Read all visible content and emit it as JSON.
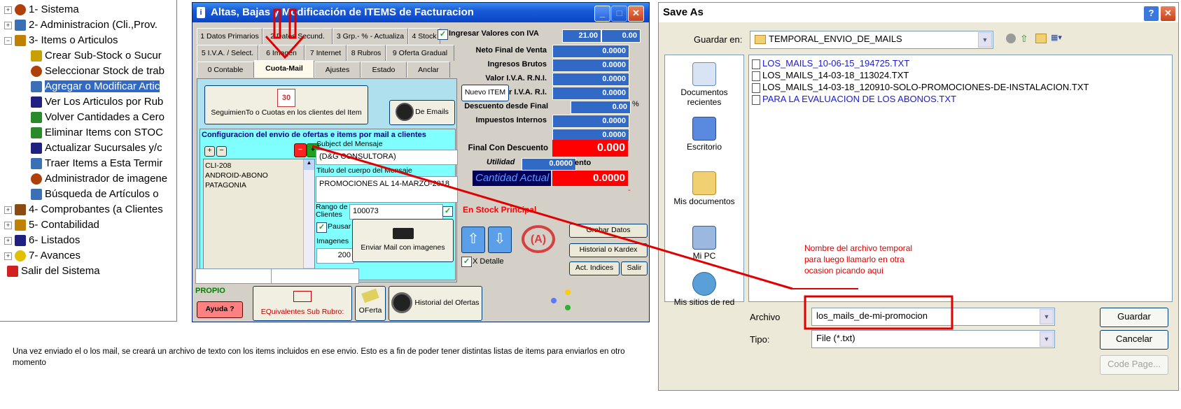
{
  "tree": {
    "items": [
      {
        "pm": "+",
        "label": "1- Sistema",
        "icon": "gear-icon",
        "color": "#b0400a"
      },
      {
        "pm": "+",
        "label": "2- Administracion (Cli.,Prov.",
        "icon": "doc-icon",
        "color": "#3b6fb6"
      },
      {
        "pm": "−",
        "label": "3- Items o Articulos",
        "icon": "folder-tree-icon",
        "color": "#c08000"
      },
      {
        "pm": "",
        "label": "Crear Sub-Stock o Sucur",
        "icon": "hand-icon",
        "color": "#c8a000"
      },
      {
        "pm": "",
        "label": "Seleccionar Stock de trab",
        "icon": "gear-icon",
        "color": "#b0400a"
      },
      {
        "pm": "",
        "label": "Agregar o Modificar Artic",
        "icon": "pen-icon",
        "color": "#3b6fb6"
      },
      {
        "pm": "",
        "label": "Ver Los Articulos por Rub",
        "icon": "chart-icon",
        "color": "#202080"
      },
      {
        "pm": "",
        "label": "Volver Cantidades a Cero",
        "icon": "traffic-light-icon",
        "color": "#2a8a2a"
      },
      {
        "pm": "",
        "label": "Eliminar Items con STOC",
        "icon": "traffic-light-icon",
        "color": "#2a8a2a"
      },
      {
        "pm": "",
        "label": "Actualizar Sucursales y/c",
        "icon": "chart-icon",
        "color": "#202080"
      },
      {
        "pm": "",
        "label": "Traer Items a Esta Termir",
        "icon": "arrows-icon",
        "color": "#3b6fb6"
      },
      {
        "pm": "",
        "label": "Administrador de imagene",
        "icon": "gear-icon",
        "color": "#b0400a"
      },
      {
        "pm": "",
        "label": "Búsqueda de Artículos o",
        "icon": "pen-icon",
        "color": "#3b6fb6"
      },
      {
        "pm": "+",
        "label": "4- Comprobantes (a Clientes",
        "icon": "books-icon",
        "color": "#8a4a10"
      },
      {
        "pm": "+",
        "label": "5- Contabilidad",
        "icon": "ledger-icon",
        "color": "#c08000"
      },
      {
        "pm": "+",
        "label": "6- Listados",
        "icon": "chart-icon",
        "color": "#202080"
      },
      {
        "pm": "+",
        "label": "7- Avances",
        "icon": "smiley-icon",
        "color": "#e0c000"
      },
      {
        "pm": "",
        "label": "Salir del Sistema",
        "icon": "x-icon",
        "color": "#d02020"
      }
    ]
  },
  "main": {
    "title": "Altas, Bajas y Modificación de ITEMS de Facturacion",
    "tabs_row1": [
      "1 Datos Primarios",
      "2 Datos Secund.",
      "3 Grp.- % - Actualiza",
      "4 Stock"
    ],
    "tabs_row2": [
      "5 I.V.A. / Select.",
      "6 Imagen",
      "7 Internet",
      "8 Rubros",
      "9 Oferta Gradual"
    ],
    "tabs_row3": [
      "0 Contable",
      "Cuota-Mail",
      "Ajustes",
      "Estado",
      "Anclar"
    ],
    "seguimiento_btn": "SeguimienTo o Cuotas en los clientes del Item",
    "calendar_num": "30",
    "de_emails_btn": "De Emails",
    "config_title": "Configuracion del envio de ofertas e items por mail a clientes",
    "plus": "+",
    "minus": "−",
    "client_list": [
      "CLI-208",
      "ANDROID-ABONO",
      "PATAGONIA"
    ],
    "subject_label": "Subject del Mensaje",
    "subject_value": "(D&G CONSULTORA)",
    "titulo_label": "Titulo del cuerpo del Mensaje",
    "titulo_value": "PROMOCIONES AL 14-MARZO-2018",
    "rango_label": "Rango de Clientes",
    "rango_value": "100073",
    "pausar_label": "Pausar",
    "imagenes_label": "Imagenes",
    "imagenes_value": "200",
    "enviar_btn": "Enviar Mail con imagenes",
    "ingresar_iva_label": "Ingresar Valores con IVA",
    "iva_rate": "21.00",
    "iva_value": "0.00",
    "fields": [
      {
        "label": "Neto Final de Venta",
        "value": "0.0000"
      },
      {
        "label": "Ingresos Brutos",
        "value": "0.0000"
      },
      {
        "label": "Valor I.V.A. R.N.I.",
        "value": "0.0000"
      },
      {
        "label": "Valor I.V.A. R.I.",
        "value": "0.0000"
      },
      {
        "label": "Descuento desde Final",
        "value": "0.00"
      },
      {
        "label": "Impuestos Internos",
        "value": "0.0000"
      },
      {
        "label": "",
        "value": "0.0000"
      }
    ],
    "nuevo_item_btn": "Nuevo ITEM",
    "percent": "%",
    "final_descuento_label": "Final Con Descuento",
    "final_descuento_value": "0.000",
    "utilidad_label": "Utilidad",
    "utilidad_value": "0.0000",
    "utilidad_suffix": "ento",
    "cantidad_label": "Cantidad Actual",
    "cantidad_value": "0.0000",
    "dot": "-",
    "stock_label": "En Stock Principal",
    "grabar_btn": "Grabar Datos",
    "historial_btn": "Historial o Kardex",
    "act_indices_btn": "Act. Indices",
    "salir_btn": "Salir",
    "x_detalle_label": "X Detalle",
    "propio_label": "PROPIO",
    "ayuda_btn": "Ayuda ?",
    "equivalentes_btn": "EQuivalentes Sub Rubro:",
    "oferta_btn": "OFerta",
    "historial_oferta_btn": "Historial del Ofertas",
    "logo_text": "(A)"
  },
  "save_dialog": {
    "title": "Save As",
    "help_btn": "?",
    "close_btn": "✕",
    "guardar_en_label": "Guardar en:",
    "folder": "TEMPORAL_ENVIO_DE_MAILS",
    "places": [
      "Documentos recientes",
      "Escritorio",
      "Mis documentos",
      "Mi PC",
      "Mis sitios de red"
    ],
    "files": [
      {
        "name": "LOS_MAILS_10-06-15_194725.TXT",
        "color": "#1a1ad8"
      },
      {
        "name": "LOS_MAILS_14-03-18_113024.TXT",
        "color": "#000000"
      },
      {
        "name": "LOS_MAILS_14-03-18_120910-SOLO-PROMOCIONES-DE-INSTALACION.TXT",
        "color": "#000000"
      },
      {
        "name": "PARA LA EVALUACION DE LOS ABONOS.TXT",
        "color": "#1a1ad8"
      }
    ],
    "archivo_label": "Archivo",
    "archivo_value": "los_mails_de-mi-promocion",
    "tipo_label": "Tipo:",
    "tipo_value": "File (*.txt)",
    "guardar_btn": "Guardar",
    "cancelar_btn": "Cancelar",
    "code_page_btn": "Code Page..."
  },
  "annotation": "Nombre del archivo temporal para luego llamarlo en otra ocasion picando aqui",
  "caption": "Una vez enviado el o los mail, se creará un archivo de texto con los items incluidos en ese envio. Esto es a fin de poder tener distintas listas de items para enviarlos en otro momento",
  "colors": {
    "accent_red": "#ff0000",
    "value_blue": "#3169c6",
    "xp_blue": "#0846c6"
  }
}
